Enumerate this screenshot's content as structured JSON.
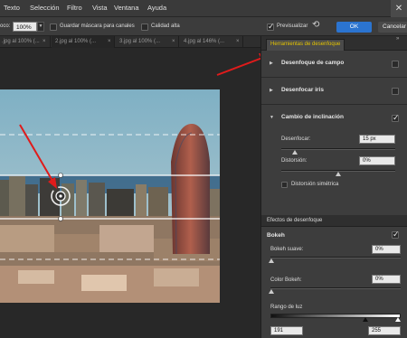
{
  "menu": {
    "items": [
      "Texto",
      "Selección",
      "Filtro",
      "Vista",
      "Ventana",
      "Ayuda"
    ]
  },
  "options": {
    "radius_label": "oco:",
    "radius_value": "100%",
    "save_mask_label": "Guardar máscara para canales",
    "save_mask_checked": false,
    "high_quality_label": "Calidad alta",
    "high_quality_checked": false,
    "preview_label": "Previsualizar",
    "preview_checked": true,
    "ok_label": "OK",
    "cancel_label": "Cancelar"
  },
  "doc_tabs": [
    ".jpg al 100% (...",
    "2.jpg al 100% (...",
    "3.jpg al 100% (...",
    "4.jpg al 146% (..."
  ],
  "blur_tools": {
    "tab_label": "Herramientas de desenfoque",
    "field_blur": {
      "label": "Desenfoque de campo",
      "checked": false
    },
    "iris_blur": {
      "label": "Desenfocar iris",
      "checked": false
    },
    "tilt_shift": {
      "label": "Cambio de inclinación",
      "checked": true,
      "blur_label": "Desenfocar:",
      "blur_value": "15 px",
      "blur_level": 0.12,
      "distortion_label": "Distorsión:",
      "distortion_value": "0%",
      "distortion_level": 0.5,
      "symmetric_label": "Distorsión simétrica",
      "symmetric_checked": false
    }
  },
  "blur_effects": {
    "tab_label": "Efectos de desenfoque",
    "bokeh_label": "Bokeh",
    "bokeh_checked": true,
    "soft_label": "Bokeh suave:",
    "soft_value": "0%",
    "color_label": "Color Bokeh:",
    "color_value": "0%",
    "light_range_label": "Rango de luz",
    "light_min": "191",
    "light_max": "255"
  },
  "colors": {
    "accent_yellow": "#e5c400",
    "ok_blue": "#2b74d0",
    "annotation_red": "#e01b1b"
  }
}
